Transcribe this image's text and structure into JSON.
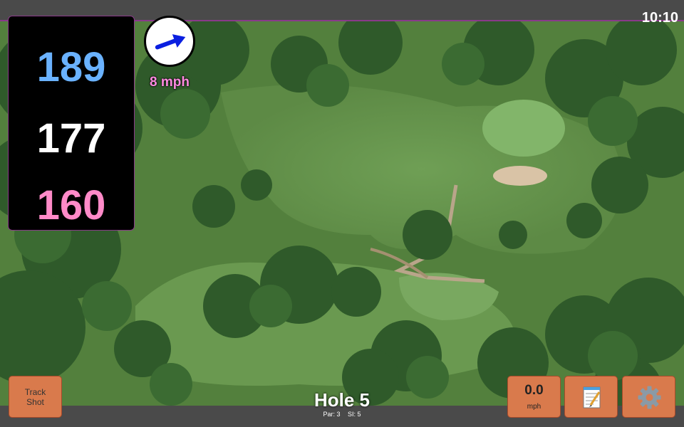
{
  "status": {
    "time": "10:10"
  },
  "yardage": {
    "back": "189",
    "middle": "177",
    "front": "160"
  },
  "wind": {
    "speed_label": "8 mph",
    "icon": "wind-arrow-icon"
  },
  "track_button": {
    "line1": "Track",
    "line2": "Shot"
  },
  "hole": {
    "title": "Hole 5",
    "par": "Par: 3",
    "si": "SI: 5"
  },
  "speed_button": {
    "value": "0.0",
    "unit": "mph"
  },
  "notes_button": {
    "icon": "notepad-icon"
  },
  "settings_button": {
    "icon": "gear-icon"
  },
  "colors": {
    "back": "#6ab2ff",
    "middle": "#ffffff",
    "front": "#ff8ac8",
    "accent": "#d97a4c",
    "wind_label": "#ff8ae0"
  }
}
